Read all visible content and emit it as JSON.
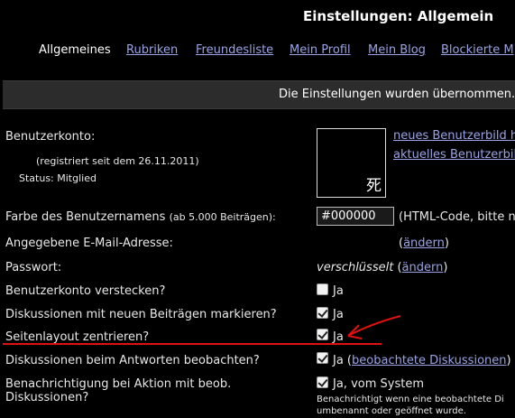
{
  "page_title": "Einstellungen: Allgemein",
  "tabs": [
    {
      "label": "Allgemeines"
    },
    {
      "label": "Rubriken"
    },
    {
      "label": "Freundesliste"
    },
    {
      "label": "Mein Profil"
    },
    {
      "label": "Mein Blog"
    },
    {
      "label": "Blockierte M"
    }
  ],
  "message": "Die Einstellungen wurden übernommen.",
  "account": {
    "label": "Benutzerkonto:",
    "registered": "(registriert seit dem 26.11.2011)",
    "status": "Status: Mitglied",
    "avatar_glyph": "死",
    "new_avatar_link": "neues Benutzerbild h",
    "current_avatar_link": "aktuelles Benutzerbil"
  },
  "name_color": {
    "label": "Farbe des Benutzernamens",
    "label_note": "(ab 5.000 Beiträgen):",
    "value": "#000000",
    "hint": "(HTML-Code, bitte n"
  },
  "email": {
    "label": "Angegebene E-Mail-Adresse:",
    "change_prefix": "(",
    "change_link": "ändern",
    "change_suffix": ")"
  },
  "password": {
    "label": "Passwort:",
    "value": "verschlüsselt",
    "change_prefix": "(",
    "change_link": "ändern",
    "change_suffix": ")"
  },
  "options": [
    {
      "label": "Benutzerkonto verstecken?",
      "value": "Ja",
      "checked": false
    },
    {
      "label": "Diskussionen mit neuen Beiträgen markieren?",
      "value": "Ja",
      "checked": true
    },
    {
      "label": "Seitenlayout zentrieren?",
      "value": "Ja",
      "checked": true
    },
    {
      "label": "Diskussionen beim Antworten beobachten?",
      "value": "Ja (",
      "link": "beobachtete Diskussionen",
      "suffix": ")",
      "checked": true
    },
    {
      "label_line1": "Benachrichtigung bei Aktion mit beob.",
      "label_line2": "Diskussionen?",
      "value": "Ja, vom System",
      "note_line1": "Benachrichtigt wenn eine beobachtete Di",
      "note_line2": "umbenannt oder geöffnet wurde.",
      "checked": true
    }
  ],
  "colors": {
    "annotation": "#e01010",
    "link": "#9aa3e6"
  }
}
